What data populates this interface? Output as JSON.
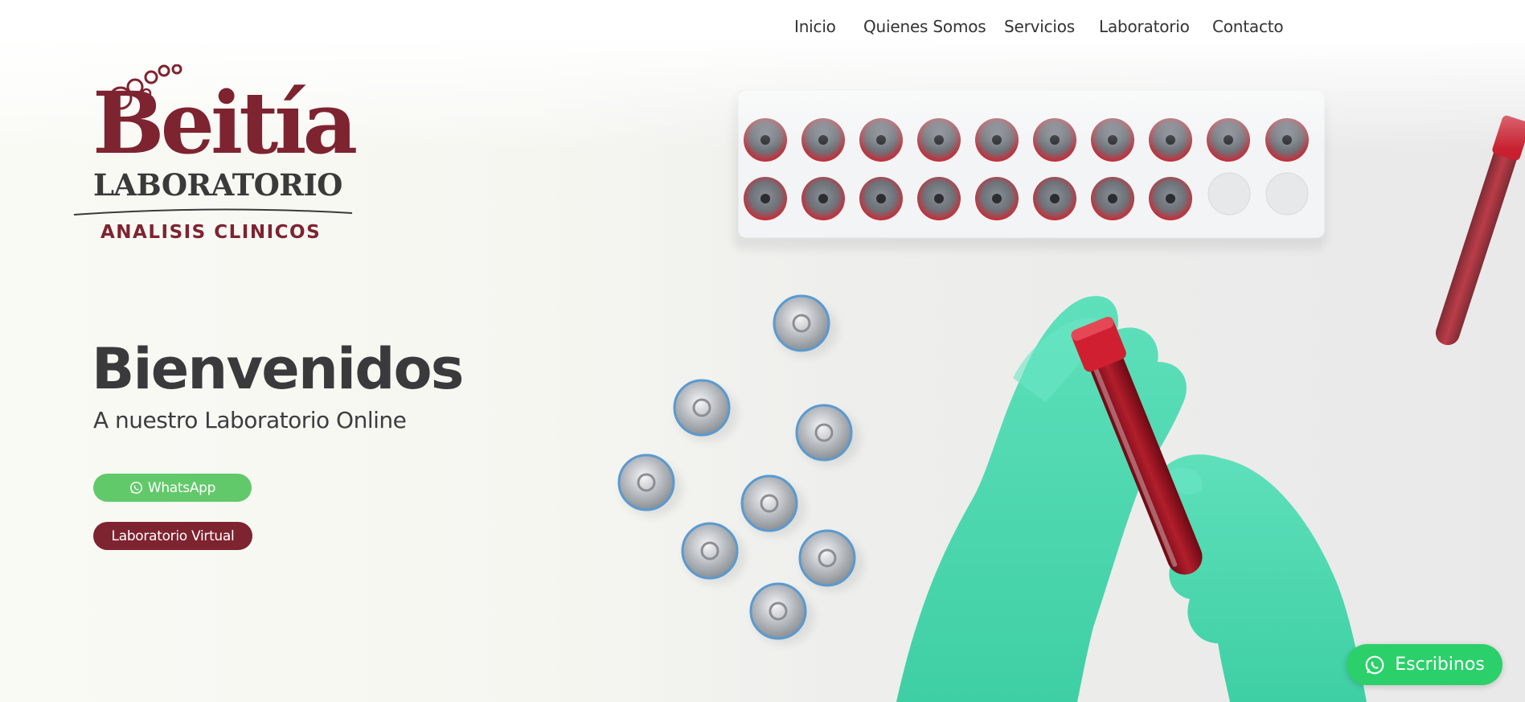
{
  "nav": {
    "items": [
      "Inicio",
      "Quienes Somos",
      "Servicios",
      "Laboratorio",
      "Contacto"
    ]
  },
  "logo": {
    "name": "Beitía",
    "subtitle": "LABORATORIO",
    "tagline": "ANALISIS CLINICOS"
  },
  "hero": {
    "title": "Bienvenidos",
    "subtitle": "A nuestro Laboratorio Online",
    "whatsapp_label": "WhatsApp",
    "lab_virtual_label": "Laboratorio Virtual"
  },
  "floating": {
    "label": "Escribinos"
  },
  "colors": {
    "brand": "#7e2330",
    "whatsapp": "#62c96b",
    "float": "#2bd06a",
    "glove": "#4fd9b0"
  },
  "icons": {
    "whatsapp": "whatsapp-icon"
  }
}
